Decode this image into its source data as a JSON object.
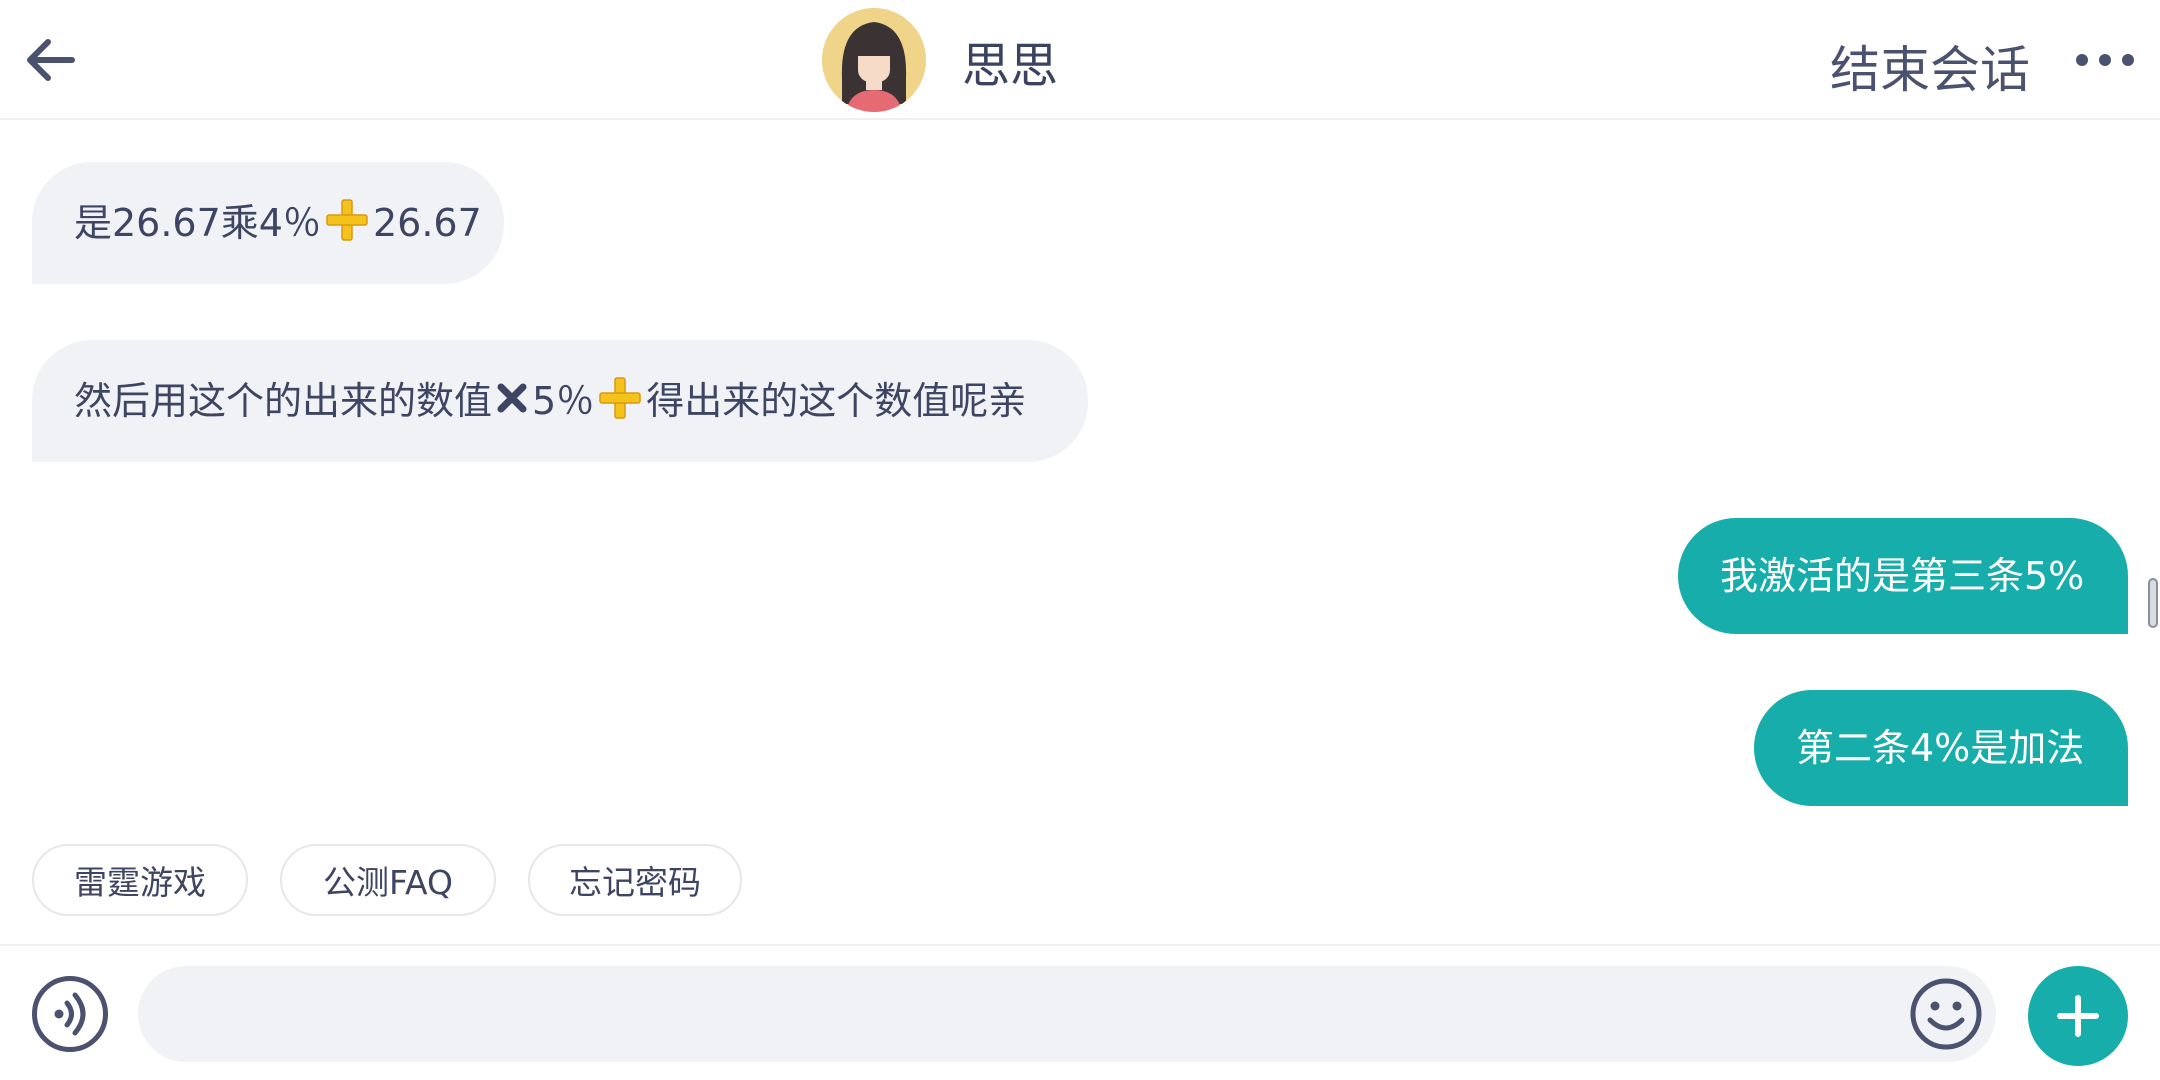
{
  "header": {
    "title": "思思",
    "end_chat_label": "结束会话",
    "back_icon": "arrow-left-icon",
    "more_icon": "more-horizontal-icon"
  },
  "messages": [
    {
      "side": "left",
      "parts": [
        "是26.67乘4％",
        "plus-emoji",
        "26.67"
      ]
    },
    {
      "side": "left",
      "parts": [
        "然后用这个的出来的数值",
        "cross-emoji",
        " 5％",
        "plus-emoji",
        "得出来的这个数值呢亲"
      ]
    },
    {
      "side": "right",
      "text": "我激活的是第三条5%"
    },
    {
      "side": "right",
      "text": "第二条4%是加法"
    }
  ],
  "quick_replies": [
    "雷霆游戏",
    "公测FAQ",
    "忘记密码"
  ],
  "composer": {
    "value": "",
    "voice_icon": "voice-icon",
    "emoji_icon": "smile-icon",
    "add_icon": "plus-icon"
  },
  "colors": {
    "accent": "#16adab",
    "bubble_left": "#f0f2f5",
    "text": "#3d4563"
  }
}
